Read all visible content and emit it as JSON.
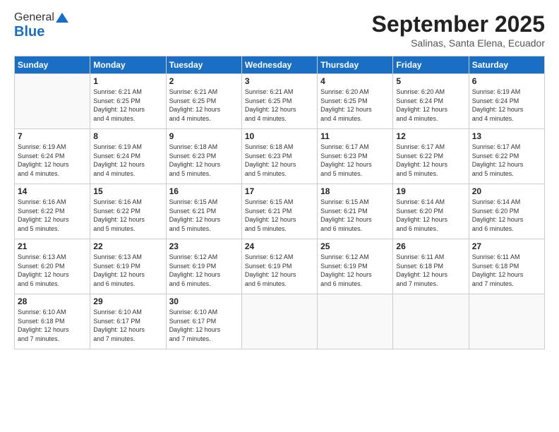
{
  "logo": {
    "general": "General",
    "blue": "Blue",
    "tagline": ""
  },
  "title": "September 2025",
  "subtitle": "Salinas, Santa Elena, Ecuador",
  "days_header": [
    "Sunday",
    "Monday",
    "Tuesday",
    "Wednesday",
    "Thursday",
    "Friday",
    "Saturday"
  ],
  "weeks": [
    [
      {
        "day": "",
        "info": ""
      },
      {
        "day": "1",
        "info": "Sunrise: 6:21 AM\nSunset: 6:25 PM\nDaylight: 12 hours\nand 4 minutes."
      },
      {
        "day": "2",
        "info": "Sunrise: 6:21 AM\nSunset: 6:25 PM\nDaylight: 12 hours\nand 4 minutes."
      },
      {
        "day": "3",
        "info": "Sunrise: 6:21 AM\nSunset: 6:25 PM\nDaylight: 12 hours\nand 4 minutes."
      },
      {
        "day": "4",
        "info": "Sunrise: 6:20 AM\nSunset: 6:25 PM\nDaylight: 12 hours\nand 4 minutes."
      },
      {
        "day": "5",
        "info": "Sunrise: 6:20 AM\nSunset: 6:24 PM\nDaylight: 12 hours\nand 4 minutes."
      },
      {
        "day": "6",
        "info": "Sunrise: 6:19 AM\nSunset: 6:24 PM\nDaylight: 12 hours\nand 4 minutes."
      }
    ],
    [
      {
        "day": "7",
        "info": "Sunrise: 6:19 AM\nSunset: 6:24 PM\nDaylight: 12 hours\nand 4 minutes."
      },
      {
        "day": "8",
        "info": "Sunrise: 6:19 AM\nSunset: 6:24 PM\nDaylight: 12 hours\nand 4 minutes."
      },
      {
        "day": "9",
        "info": "Sunrise: 6:18 AM\nSunset: 6:23 PM\nDaylight: 12 hours\nand 5 minutes."
      },
      {
        "day": "10",
        "info": "Sunrise: 6:18 AM\nSunset: 6:23 PM\nDaylight: 12 hours\nand 5 minutes."
      },
      {
        "day": "11",
        "info": "Sunrise: 6:17 AM\nSunset: 6:23 PM\nDaylight: 12 hours\nand 5 minutes."
      },
      {
        "day": "12",
        "info": "Sunrise: 6:17 AM\nSunset: 6:22 PM\nDaylight: 12 hours\nand 5 minutes."
      },
      {
        "day": "13",
        "info": "Sunrise: 6:17 AM\nSunset: 6:22 PM\nDaylight: 12 hours\nand 5 minutes."
      }
    ],
    [
      {
        "day": "14",
        "info": "Sunrise: 6:16 AM\nSunset: 6:22 PM\nDaylight: 12 hours\nand 5 minutes."
      },
      {
        "day": "15",
        "info": "Sunrise: 6:16 AM\nSunset: 6:22 PM\nDaylight: 12 hours\nand 5 minutes."
      },
      {
        "day": "16",
        "info": "Sunrise: 6:15 AM\nSunset: 6:21 PM\nDaylight: 12 hours\nand 5 minutes."
      },
      {
        "day": "17",
        "info": "Sunrise: 6:15 AM\nSunset: 6:21 PM\nDaylight: 12 hours\nand 5 minutes."
      },
      {
        "day": "18",
        "info": "Sunrise: 6:15 AM\nSunset: 6:21 PM\nDaylight: 12 hours\nand 6 minutes."
      },
      {
        "day": "19",
        "info": "Sunrise: 6:14 AM\nSunset: 6:20 PM\nDaylight: 12 hours\nand 6 minutes."
      },
      {
        "day": "20",
        "info": "Sunrise: 6:14 AM\nSunset: 6:20 PM\nDaylight: 12 hours\nand 6 minutes."
      }
    ],
    [
      {
        "day": "21",
        "info": "Sunrise: 6:13 AM\nSunset: 6:20 PM\nDaylight: 12 hours\nand 6 minutes."
      },
      {
        "day": "22",
        "info": "Sunrise: 6:13 AM\nSunset: 6:19 PM\nDaylight: 12 hours\nand 6 minutes."
      },
      {
        "day": "23",
        "info": "Sunrise: 6:12 AM\nSunset: 6:19 PM\nDaylight: 12 hours\nand 6 minutes."
      },
      {
        "day": "24",
        "info": "Sunrise: 6:12 AM\nSunset: 6:19 PM\nDaylight: 12 hours\nand 6 minutes."
      },
      {
        "day": "25",
        "info": "Sunrise: 6:12 AM\nSunset: 6:19 PM\nDaylight: 12 hours\nand 6 minutes."
      },
      {
        "day": "26",
        "info": "Sunrise: 6:11 AM\nSunset: 6:18 PM\nDaylight: 12 hours\nand 7 minutes."
      },
      {
        "day": "27",
        "info": "Sunrise: 6:11 AM\nSunset: 6:18 PM\nDaylight: 12 hours\nand 7 minutes."
      }
    ],
    [
      {
        "day": "28",
        "info": "Sunrise: 6:10 AM\nSunset: 6:18 PM\nDaylight: 12 hours\nand 7 minutes."
      },
      {
        "day": "29",
        "info": "Sunrise: 6:10 AM\nSunset: 6:17 PM\nDaylight: 12 hours\nand 7 minutes."
      },
      {
        "day": "30",
        "info": "Sunrise: 6:10 AM\nSunset: 6:17 PM\nDaylight: 12 hours\nand 7 minutes."
      },
      {
        "day": "",
        "info": ""
      },
      {
        "day": "",
        "info": ""
      },
      {
        "day": "",
        "info": ""
      },
      {
        "day": "",
        "info": ""
      }
    ]
  ]
}
